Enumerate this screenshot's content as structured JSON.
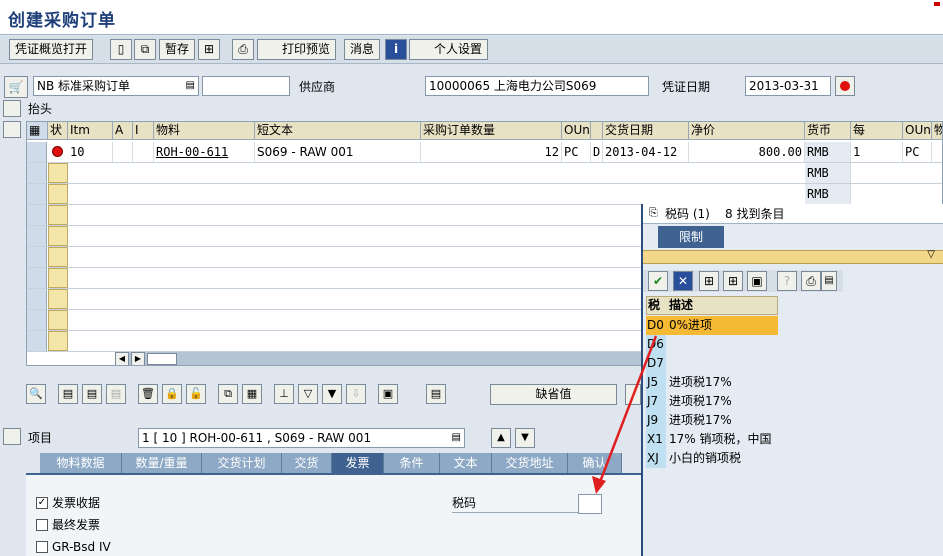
{
  "title": "创建采购订单",
  "toolbar": {
    "voucher_overview": "凭证概览打开",
    "hold": "暂存",
    "print_preview": "打印预览",
    "messages": "消息",
    "personal_settings": "个人设置"
  },
  "header": {
    "doc_type": "NB 标准采购订单",
    "vendor_label": "供应商",
    "vendor_value": "10000065 上海电力公司S069",
    "doc_date_label": "凭证日期",
    "doc_date_value": "2013-03-31",
    "header_label": "抬头"
  },
  "grid": {
    "columns": [
      "状",
      "Itm",
      "A",
      "I",
      "物料",
      "短文本",
      "采购订单数量",
      "OUn",
      "",
      "交货日期",
      "净价",
      "货币",
      "每",
      "OUn",
      "物"
    ],
    "row1": {
      "itm": "10",
      "material": "ROH-00-611",
      "short_text": "S069 - RAW 001",
      "qty": "12",
      "oun": "PC",
      "d": "D",
      "delivery_date": "2013-04-12",
      "net_price": "800.00",
      "currency": "RMB",
      "per": "1",
      "oun2": "PC"
    },
    "row2_currency": "RMB",
    "row3_currency": "RMB"
  },
  "default_values": "缺省值",
  "item": {
    "label": "项目",
    "value": "1 [ 10 ] ROH-00-611 , S069 - RAW 001"
  },
  "tabs": [
    "物料数据",
    "数量/重量",
    "交货计划",
    "交货",
    "发票",
    "条件",
    "文本",
    "交货地址",
    "确认"
  ],
  "invoice": {
    "invoice_receipt": "发票收据",
    "final_invoice": "最终发票",
    "gr_based_iv": "GR-Bsd IV",
    "tax_code_label": "税码"
  },
  "popup": {
    "title": "税码 (1)",
    "found": "8 找到条目",
    "restriction_tab": "限制",
    "col_tax": "税",
    "col_desc": "描述",
    "rows": [
      {
        "code": "D0",
        "desc": "0%进项"
      },
      {
        "code": "D6",
        "desc": ""
      },
      {
        "code": "D7",
        "desc": ""
      },
      {
        "code": "J5",
        "desc": "进项税17%"
      },
      {
        "code": "J7",
        "desc": "进项税17%"
      },
      {
        "code": "J9",
        "desc": "进项税17%"
      },
      {
        "code": "X1",
        "desc": "17% 销项税，中国"
      },
      {
        "code": "XJ",
        "desc": "小白的销项税"
      }
    ]
  },
  "colors": {
    "accent": "#1f3f7a",
    "highlight": "#f5b934",
    "arrow": "#e02020"
  }
}
